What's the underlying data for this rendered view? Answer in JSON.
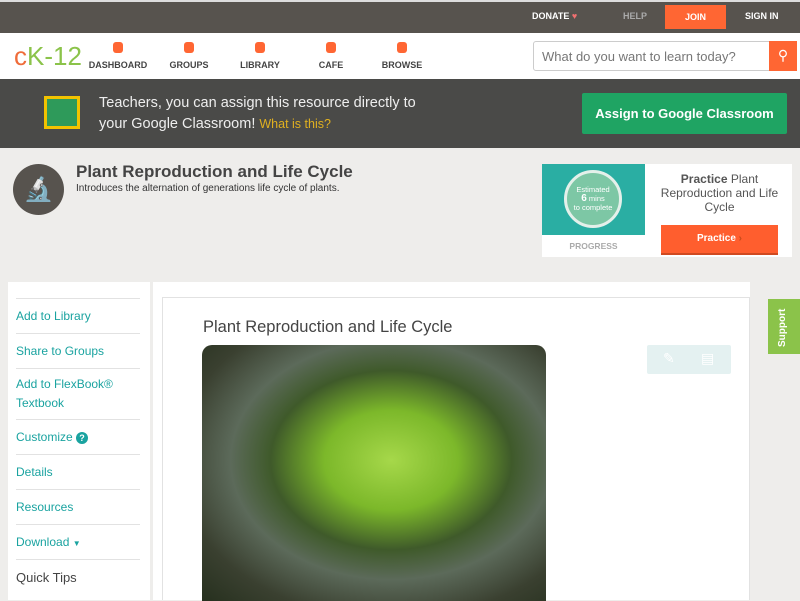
{
  "topbar": {
    "donate": "DONATE",
    "help": "HELP",
    "join": "JOIN",
    "signin": "SIGN IN"
  },
  "nav": {
    "logo_c": "c",
    "logo_rest": "K-12",
    "items": [
      "DASHBOARD",
      "GROUPS",
      "LIBRARY",
      "CAFE",
      "BROWSE"
    ],
    "search_placeholder": "What do you want to learn today?"
  },
  "classroom": {
    "line1": "Teachers, you can assign this resource directly to",
    "line2": "your Google Classroom!",
    "link": "What is this?",
    "button": "Assign to Google Classroom"
  },
  "header": {
    "title": "Plant Reproduction and Life Cycle",
    "description": "Introduces the alternation of generations life cycle of plants."
  },
  "practice": {
    "est1": "Estimated",
    "est_num": "6",
    "est_unit": "mins",
    "est3": "to complete",
    "progress": "PROGRESS",
    "title_bold": "Practice",
    "title_rest": "Plant Reproduction and Life Cycle",
    "button": "Practice"
  },
  "sidebar": {
    "items": [
      "Add to Library",
      "Share to Groups",
      "Add to FlexBook® Textbook",
      "Customize",
      "Details",
      "Resources",
      "Download"
    ],
    "quick_tips": "Quick Tips"
  },
  "main": {
    "title": "Plant Reproduction and Life Cycle"
  },
  "support": "Support"
}
